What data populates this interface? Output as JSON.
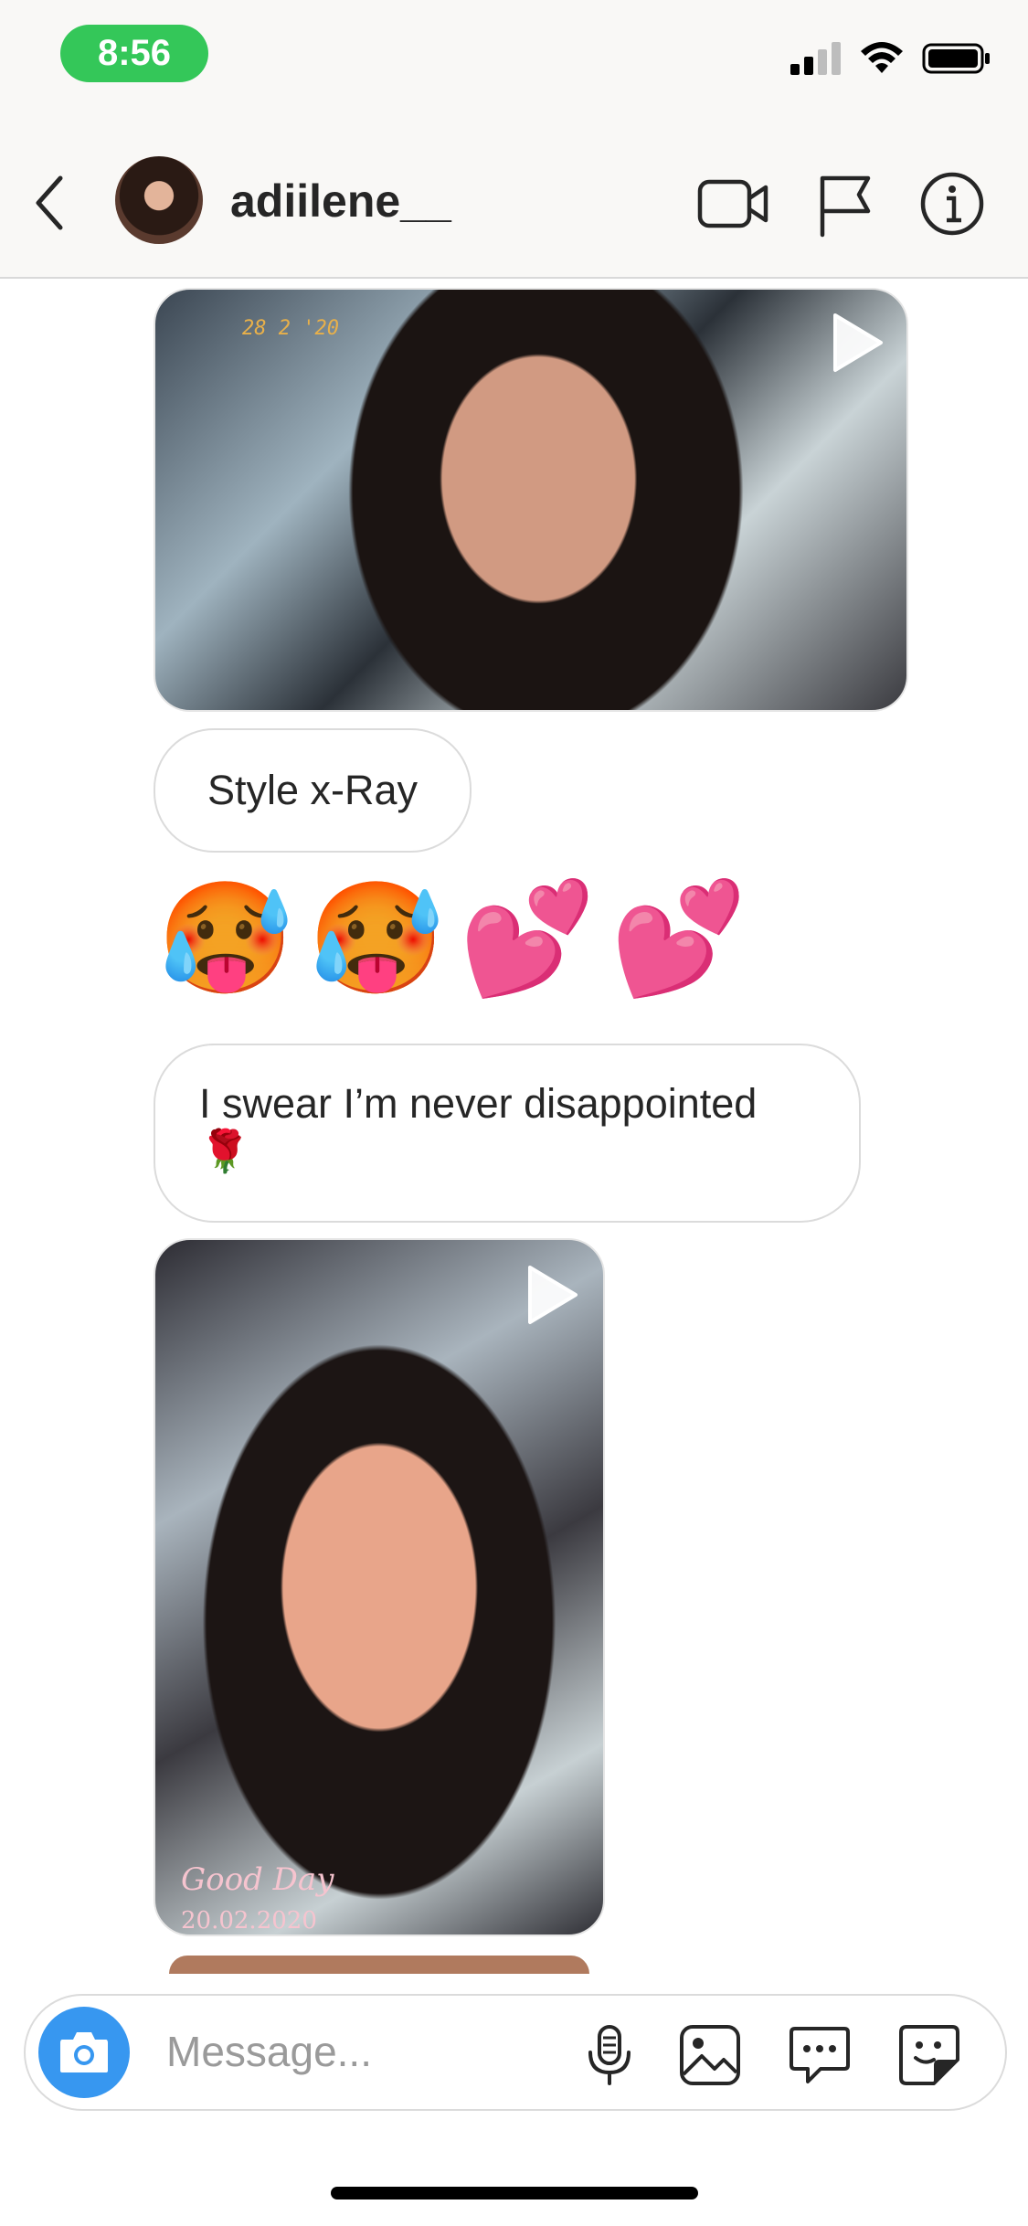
{
  "status_bar": {
    "time": "8:56"
  },
  "header": {
    "username": "adiilene__"
  },
  "messages": [
    {
      "type": "video",
      "date_overlay": "28 2 '20"
    },
    {
      "type": "text",
      "text": "Style x-Ray"
    },
    {
      "type": "emoji",
      "text": "🥵🥵💕💕"
    },
    {
      "type": "text",
      "text": "I swear I’m never disappointed",
      "emoji": "🌹"
    },
    {
      "type": "video",
      "caption": "Good Day",
      "caption_date": "20.02.2020"
    }
  ],
  "composer": {
    "placeholder": "Message..."
  },
  "colors": {
    "accent": "#3797f0",
    "time_pill": "#34c759"
  },
  "icons": [
    "back-icon",
    "video-call-icon",
    "flag-icon",
    "info-icon",
    "camera-icon",
    "microphone-icon",
    "gallery-icon",
    "chat-icon",
    "sticker-icon",
    "play-icon"
  ]
}
